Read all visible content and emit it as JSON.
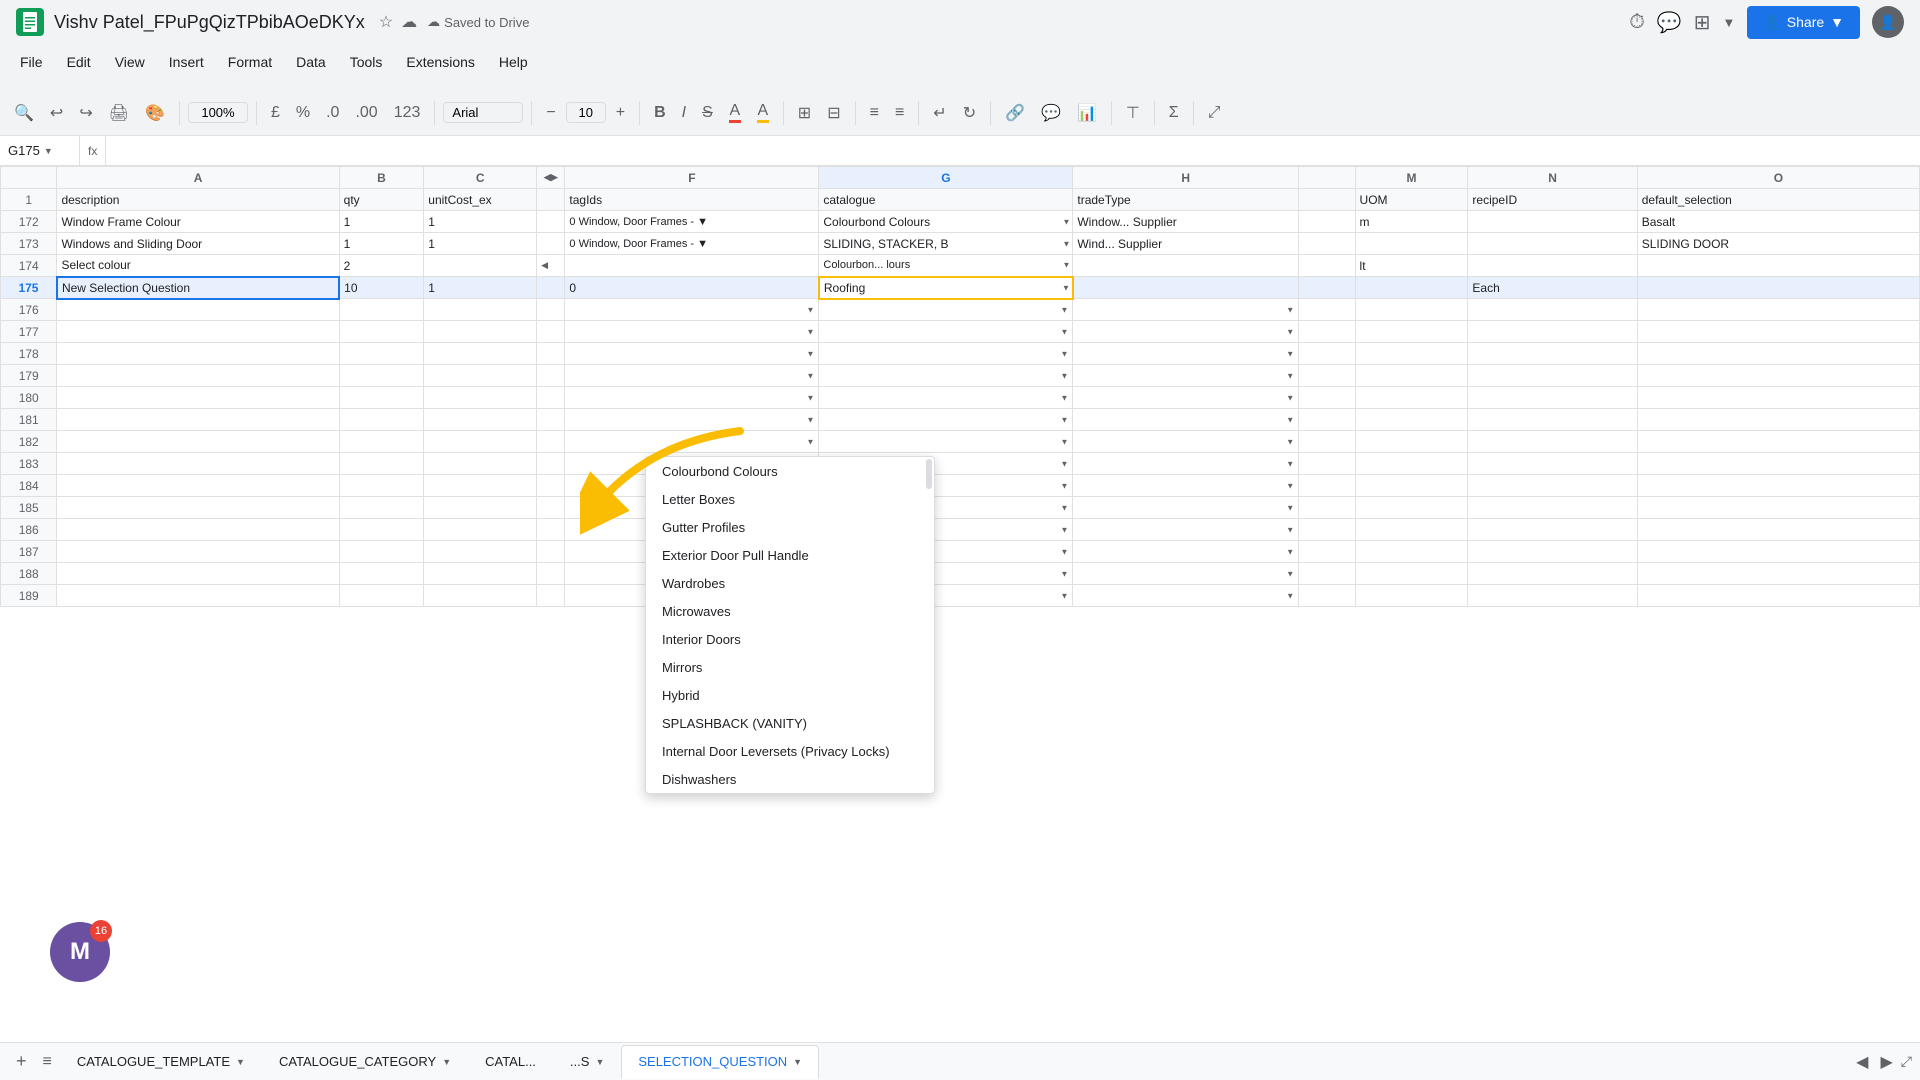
{
  "app": {
    "title": "Vishv Patel_FPuPgQizTPbibAOeDKYx",
    "saved_status": "Saved to Drive"
  },
  "menu": {
    "items": [
      "File",
      "Edit",
      "View",
      "Insert",
      "Format",
      "Data",
      "Tools",
      "Extensions",
      "Help"
    ]
  },
  "toolbar": {
    "zoom": "100%",
    "currency_symbol": "£",
    "percent_symbol": "%",
    "decrease_decimals": ".0",
    "increase_decimals": ".00",
    "format_123": "123",
    "font": "Arial",
    "font_size": "10"
  },
  "formula_bar": {
    "cell_ref": "G175",
    "formula_icon": "fx",
    "content": ""
  },
  "columns": {
    "headers": [
      "",
      "A",
      "B",
      "C",
      "",
      "F",
      "G",
      "H",
      "",
      "M",
      "N",
      "O"
    ],
    "labels": {
      "A": "description",
      "B": "qty",
      "C": "unitCost_ex",
      "F": "tagIds",
      "G": "catalogue",
      "H": "tradeType",
      "M": "UOM",
      "N": "recipeID",
      "O": "default_selection"
    }
  },
  "rows": [
    {
      "num": "172",
      "A": "Window Frame Colour",
      "B": "1",
      "C": "1",
      "F": "0 Window, Door Frames - ▼",
      "G": "Colourbond Colours",
      "H": "Window... Supplier",
      "M": "m",
      "N": "",
      "O": "Basalt"
    },
    {
      "num": "173",
      "A": "Windows and Sliding Door",
      "B": "1",
      "C": "1",
      "F": "0 Window, Door Frames - ▼",
      "G": "SLIDING, STACKER, B ▼",
      "H": "Wind... Supplier",
      "M": "",
      "N": "",
      "O": "SLIDING DOOR"
    },
    {
      "num": "174",
      "A": "Select colour",
      "B": "2",
      "C": "",
      "F": "",
      "G": "Colourbon... lours",
      "H": "",
      "M": "lt",
      "N": "",
      "O": ""
    },
    {
      "num": "175",
      "A": "New Selection Question",
      "B": "10",
      "C": "1",
      "F": "0",
      "G": "Roofing",
      "H": "",
      "M": "",
      "N": "",
      "O": ""
    },
    {
      "num": "176",
      "A": "",
      "B": "",
      "C": "",
      "F": "",
      "G": "",
      "H": "",
      "M": "",
      "N": "",
      "O": ""
    },
    {
      "num": "177",
      "A": "",
      "B": "",
      "C": "",
      "F": "",
      "G": "",
      "H": "",
      "M": "",
      "N": "",
      "O": ""
    },
    {
      "num": "178",
      "A": "",
      "B": "",
      "C": "",
      "F": "",
      "G": "",
      "H": "",
      "M": "",
      "N": "",
      "O": ""
    },
    {
      "num": "179",
      "A": "",
      "B": "",
      "C": "",
      "F": "",
      "G": "",
      "H": "",
      "M": "",
      "N": "",
      "O": ""
    },
    {
      "num": "180",
      "A": "",
      "B": "",
      "C": "",
      "F": "",
      "G": "",
      "H": "",
      "M": "",
      "N": "",
      "O": ""
    },
    {
      "num": "181",
      "A": "",
      "B": "",
      "C": "",
      "F": "",
      "G": "",
      "H": "",
      "M": "",
      "N": "",
      "O": ""
    },
    {
      "num": "182",
      "A": "",
      "B": "",
      "C": "",
      "F": "",
      "G": "",
      "H": "",
      "M": "",
      "N": "",
      "O": ""
    },
    {
      "num": "183",
      "A": "",
      "B": "",
      "C": "",
      "F": "",
      "G": "",
      "H": "",
      "M": "",
      "N": "",
      "O": ""
    },
    {
      "num": "184",
      "A": "",
      "B": "",
      "C": "",
      "F": "",
      "G": "",
      "H": "",
      "M": "",
      "N": "",
      "O": ""
    },
    {
      "num": "185",
      "A": "",
      "B": "",
      "C": "",
      "F": "",
      "G": "",
      "H": "",
      "M": "",
      "N": "",
      "O": ""
    },
    {
      "num": "186",
      "A": "",
      "B": "",
      "C": "",
      "F": "",
      "G": "",
      "H": "",
      "M": "",
      "N": "",
      "O": ""
    },
    {
      "num": "187",
      "A": "",
      "B": "",
      "C": "",
      "F": "",
      "G": "",
      "H": "",
      "M": "",
      "N": "",
      "O": ""
    },
    {
      "num": "188",
      "A": "",
      "B": "",
      "C": "",
      "F": "",
      "G": "",
      "H": "",
      "M": "",
      "N": "",
      "O": ""
    },
    {
      "num": "189",
      "A": "",
      "B": "",
      "C": "",
      "F": "",
      "G": "",
      "H": "",
      "M": "",
      "N": "",
      "O": ""
    }
  ],
  "dropdown": {
    "items": [
      "Colourbond Colours",
      "Letter Boxes",
      "Gutter Profiles",
      "Exterior Door Pull Handle",
      "Wardrobes",
      "Microwaves",
      "Interior Doors",
      "Mirrors",
      "Hybrid",
      "SPLASHBACK (VANITY)",
      "Internal Door Leversets (Privacy Locks)",
      "Dishwashers"
    ]
  },
  "tabs": {
    "sheets": [
      {
        "label": "CATALOGUE_TEMPLATE",
        "active": false
      },
      {
        "label": "CATALOGUE_CATEGORY",
        "active": false
      },
      {
        "label": "CATAL...",
        "active": false
      },
      {
        "label": "...S",
        "active": false
      },
      {
        "label": "SELECTION_QUESTION",
        "active": true
      }
    ]
  },
  "icons": {
    "undo": "↩",
    "redo": "↪",
    "print": "🖨",
    "paint": "🎨",
    "search": "🔍",
    "share": "👤",
    "history": "⏱",
    "comment": "💬",
    "meeting": "⬜",
    "chevron_down": "▼",
    "star": "☆",
    "cloud": "☁",
    "bold": "B",
    "italic": "I",
    "strikethrough": "S̶",
    "underline": "U",
    "fill_color": "A",
    "text_color": "A",
    "borders": "⊞",
    "merge": "⊟",
    "align_left": "≡",
    "align_right": "≡",
    "wrap": "↵",
    "rotate": "↻",
    "link": "🔗",
    "comment_cell": "💬",
    "chart": "📊",
    "filter": "⊤",
    "sigma": "Σ",
    "expand": "⤢",
    "plus": "+",
    "minus": "−"
  },
  "notification_count": "16"
}
